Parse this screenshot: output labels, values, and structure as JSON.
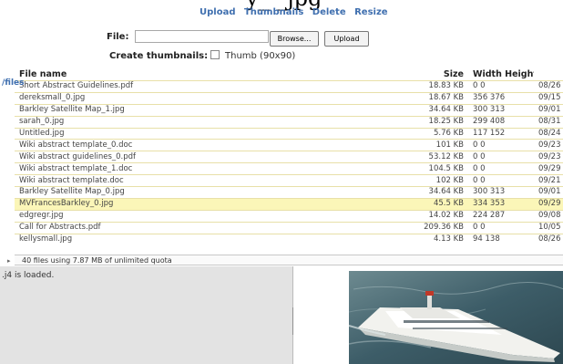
{
  "page": {
    "title": "y_ _jpg"
  },
  "toolbar": {
    "links": [
      {
        "name": "tab-upload",
        "label": "Upload"
      },
      {
        "name": "tab-thumbnails",
        "label": "Thumbnails"
      },
      {
        "name": "tab-delete",
        "label": "Delete"
      },
      {
        "name": "tab-resize",
        "label": "Resize"
      }
    ]
  },
  "upload_form": {
    "file_label": "File:",
    "file_value": "",
    "browse_label": "Browse...",
    "upload_label": "Upload",
    "thumbnails_label": "Create thumbnails:",
    "thumb_option": "Thumb (90x90)",
    "thumb_checked": false
  },
  "folder": {
    "path": "/files"
  },
  "table": {
    "headers": {
      "name": "File name",
      "size": "Size",
      "wh": "Width Height",
      "date": ""
    },
    "rows": [
      {
        "name": "Short Abstract Guidelines.pdf",
        "size": "18.83 KB",
        "wh": "0 0",
        "date": "08/26"
      },
      {
        "name": "dereksmall_0.jpg",
        "size": "18.67 KB",
        "wh": "356 376",
        "date": "09/15"
      },
      {
        "name": "Barkley Satellite Map_1.jpg",
        "size": "34.64 KB",
        "wh": "300 313",
        "date": "09/01"
      },
      {
        "name": "sarah_0.jpg",
        "size": "18.25 KB",
        "wh": "299 408",
        "date": "08/31"
      },
      {
        "name": "Untitled.jpg",
        "size": "5.76 KB",
        "wh": "117 152",
        "date": "08/24"
      },
      {
        "name": "Wiki abstract template_0.doc",
        "size": "101 KB",
        "wh": "0 0",
        "date": "09/23"
      },
      {
        "name": "Wiki abstract guidelines_0.pdf",
        "size": "53.12 KB",
        "wh": "0 0",
        "date": "09/23"
      },
      {
        "name": "Wiki abstract template_1.doc",
        "size": "104.5 KB",
        "wh": "0 0",
        "date": "09/29"
      },
      {
        "name": "Wiki abstract template.doc",
        "size": "102 KB",
        "wh": "0 0",
        "date": "09/21"
      },
      {
        "name": "Barkley Satellite Map_0.jpg",
        "size": "34.64 KB",
        "wh": "300 313",
        "date": "09/01"
      },
      {
        "name": "MVFrancesBarkley_0.jpg",
        "size": "45.5 KB",
        "wh": "334 353",
        "date": "09/29",
        "selected": true
      },
      {
        "name": "edgregr.jpg",
        "size": "14.02 KB",
        "wh": "224 287",
        "date": "09/08"
      },
      {
        "name": "Call for Abstracts.pdf",
        "size": "209.36 KB",
        "wh": "0 0",
        "date": "10/05"
      },
      {
        "name": "kellysmall.jpg",
        "size": "4.13 KB",
        "wh": "94 138",
        "date": "08/26"
      }
    ]
  },
  "status": {
    "summary": "40 files using 7.87 MB of unlimited quota",
    "expander": "▸"
  },
  "log": {
    "message": ".j4 is loaded."
  },
  "preview": {
    "alt": "ship-photo",
    "colors": {
      "sea": "#3d5d68",
      "hull": "#f2f2ee",
      "accent": "#c03828"
    }
  }
}
